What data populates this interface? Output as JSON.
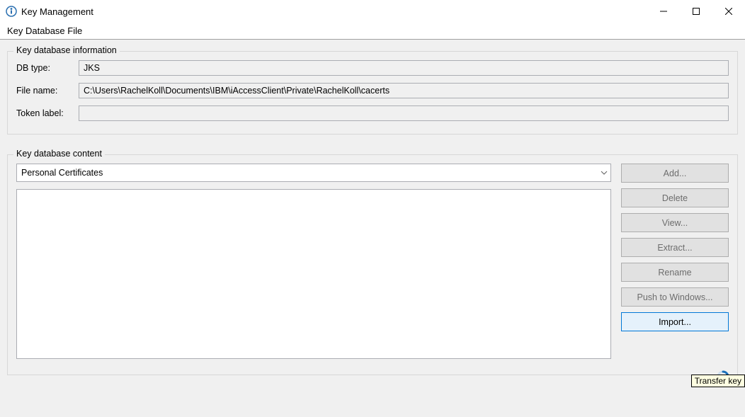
{
  "window": {
    "title": "Key Management"
  },
  "menu": {
    "keyDatabaseFile": "Key Database File"
  },
  "dbInfo": {
    "legend": "Key database information",
    "dbTypeLabel": "DB type:",
    "dbTypeValue": "JKS",
    "fileNameLabel": "File name:",
    "fileNameValue": "C:\\Users\\RachelKoll\\Documents\\IBM\\iAccessClient\\Private\\RachelKoll\\cacerts",
    "tokenLabelLabel": "Token label:",
    "tokenLabelValue": ""
  },
  "content": {
    "legend": "Key database content",
    "dropdownSelected": "Personal Certificates",
    "buttons": {
      "add": "Add...",
      "delete": "Delete",
      "view": "View...",
      "extract": "Extract...",
      "rename": "Rename",
      "push": "Push to Windows...",
      "import": "Import..."
    }
  },
  "tooltip": "Transfer key"
}
